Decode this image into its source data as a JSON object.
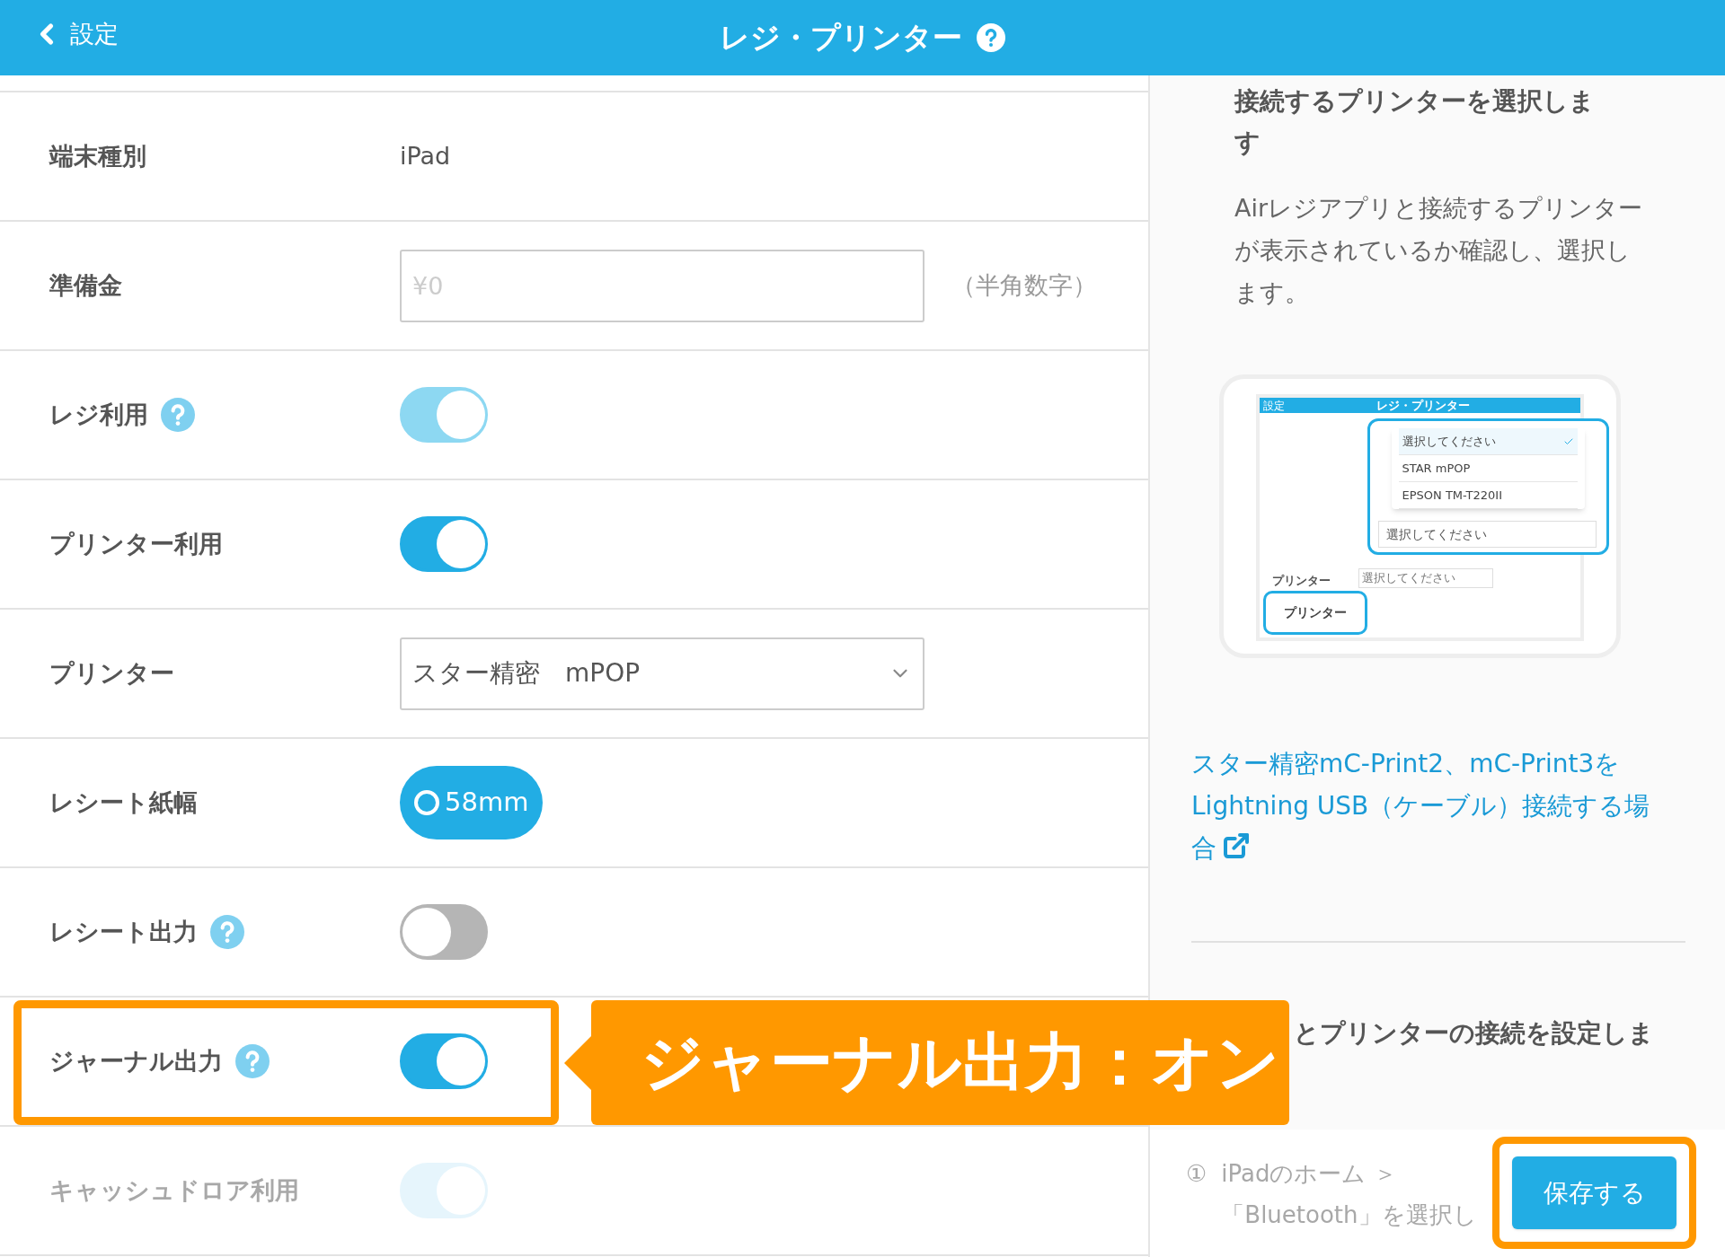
{
  "header": {
    "back_label": "設定",
    "title": "レジ・プリンター"
  },
  "settings": [
    {
      "kind": "text",
      "label": "端末種別",
      "value": "iPad",
      "help": false,
      "faded": false
    },
    {
      "kind": "input",
      "label": "準備金",
      "placeholder": "¥0",
      "note": "（半角数字）",
      "help": false,
      "faded": false
    },
    {
      "kind": "toggle",
      "label": "レジ利用",
      "help": true,
      "on": true,
      "disabled": true,
      "faded": false
    },
    {
      "kind": "toggle",
      "label": "プリンター利用",
      "help": false,
      "on": true,
      "disabled": false,
      "faded": false
    },
    {
      "kind": "select",
      "label": "プリンター",
      "value": "スター精密　mPOP",
      "help": false,
      "faded": false
    },
    {
      "kind": "radio",
      "label": "レシート紙幅",
      "options": [
        {
          "label": "58mm",
          "selected": true
        }
      ],
      "help": false,
      "faded": false
    },
    {
      "kind": "toggle",
      "label": "レシート出力",
      "help": true,
      "on": false,
      "faded": false
    },
    {
      "kind": "toggle",
      "label": "ジャーナル出力",
      "help": true,
      "on": true,
      "disabled": false,
      "faded": false
    },
    {
      "kind": "toggle",
      "label": "キャッシュドロア利用",
      "help": false,
      "on": true,
      "faded": true
    }
  ],
  "guide": {
    "heading": "接続するプリンターを選択します",
    "body": "Airレジアプリと接続するプリンターが表示されているか確認し、選択します。",
    "illustration": {
      "title": "レジ・プリンター",
      "back_label": "設定",
      "options": [
        {
          "label": "選択してください",
          "selected": true
        },
        {
          "label": "STAR mPOP",
          "selected": false
        },
        {
          "label": "EPSON TM-T220II",
          "selected": false
        }
      ],
      "select_value": "選択してください",
      "small_select_value": "選択してください",
      "callout": "プリンター",
      "row_label": "プリンター"
    },
    "link": "スター精密mC-Print2、mC-Print3をLightning USB（ケーブル）接続する場合",
    "heading_2": "とプリンターの接続を設定しま",
    "steps": [
      {
        "number": "①",
        "lines": [
          "iPadのホーム ＞",
          "「Bluetooth」を選択し"
        ]
      }
    ]
  },
  "save_button": "保存する",
  "annotation": "ジャーナル出力：オン"
}
